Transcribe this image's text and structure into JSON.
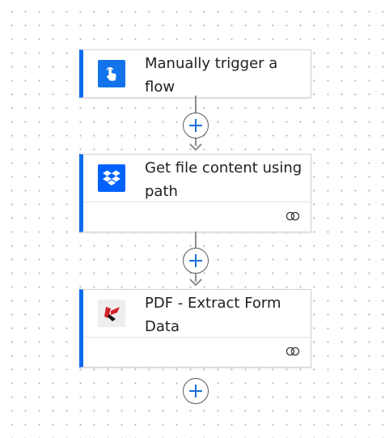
{
  "flow": {
    "steps": [
      {
        "title": "Manually trigger a flow",
        "icon": "touch-hand-icon",
        "color": "#1273eb",
        "has_link": false
      },
      {
        "title": "Get file content using path",
        "icon": "dropbox-icon",
        "color": "#0061fe",
        "has_link": true
      },
      {
        "title": "PDF - Extract Form Data",
        "icon": "pdf-extract-icon",
        "color": "#d32027",
        "has_link": true
      }
    ],
    "accent_color": "#0f6cf0",
    "add_button_color": "#1a6fd8"
  }
}
